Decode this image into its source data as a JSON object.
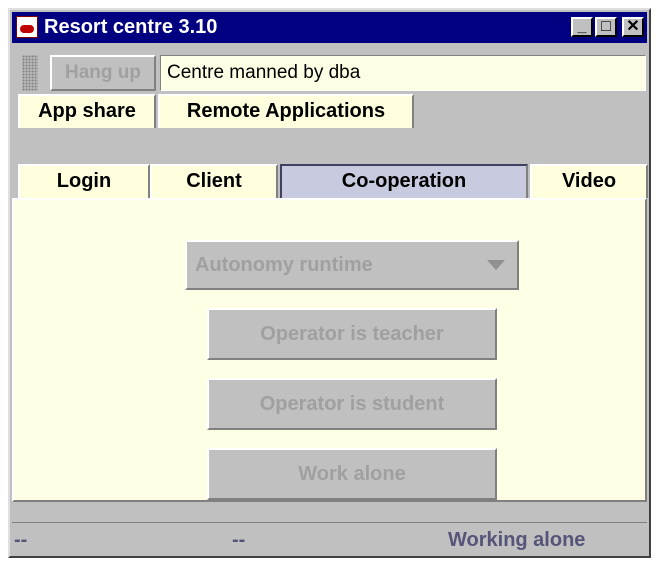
{
  "window": {
    "title": "Resort centre 3.10",
    "controls": {
      "minimize": "_",
      "maximize": "□",
      "close": "✕"
    },
    "icon": "resort-app-icon"
  },
  "toolbar": {
    "hangup_label": "Hang up",
    "status_text": "Centre manned by dba"
  },
  "tabs": {
    "row1": [
      "App share",
      "Remote Applications"
    ],
    "row2": [
      "Login",
      "Client",
      "Co-operation",
      "Video"
    ],
    "selected": "Co-operation"
  },
  "cooperation": {
    "mode_select": {
      "value": "Autonomy runtime"
    },
    "buttons": [
      "Operator is teacher",
      "Operator is student",
      "Work alone"
    ]
  },
  "statusbar": {
    "left": "--",
    "middle": "--",
    "right": "Working alone"
  },
  "colors": {
    "titlebar": "#000080",
    "panel_background": "#ffffe6",
    "selected_tab": "#c8cbe0",
    "disabled_text": "#a0a0a0"
  }
}
